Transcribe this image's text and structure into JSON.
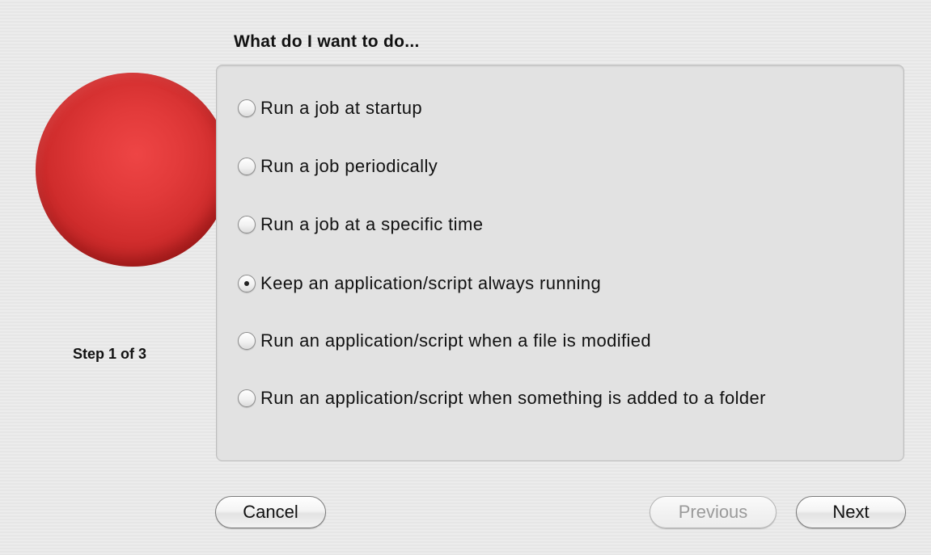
{
  "heading": "What do I want to do...",
  "logo": "red-sphere",
  "step_label": "Step 1 of 3",
  "options": [
    {
      "label": "Run a job at startup",
      "selected": false
    },
    {
      "label": "Run a job periodically",
      "selected": false
    },
    {
      "label": "Run a job at a specific time",
      "selected": false
    },
    {
      "label": "Keep an application/script always running",
      "selected": true
    },
    {
      "label": "Run an application/script when a file is modified",
      "selected": false
    },
    {
      "label": "Run an application/script when something is added to a folder",
      "selected": false
    }
  ],
  "buttons": {
    "cancel": {
      "label": "Cancel",
      "enabled": true
    },
    "previous": {
      "label": "Previous",
      "enabled": false
    },
    "next": {
      "label": "Next",
      "enabled": true
    }
  },
  "colors": {
    "accent_sphere": "#d83232"
  }
}
